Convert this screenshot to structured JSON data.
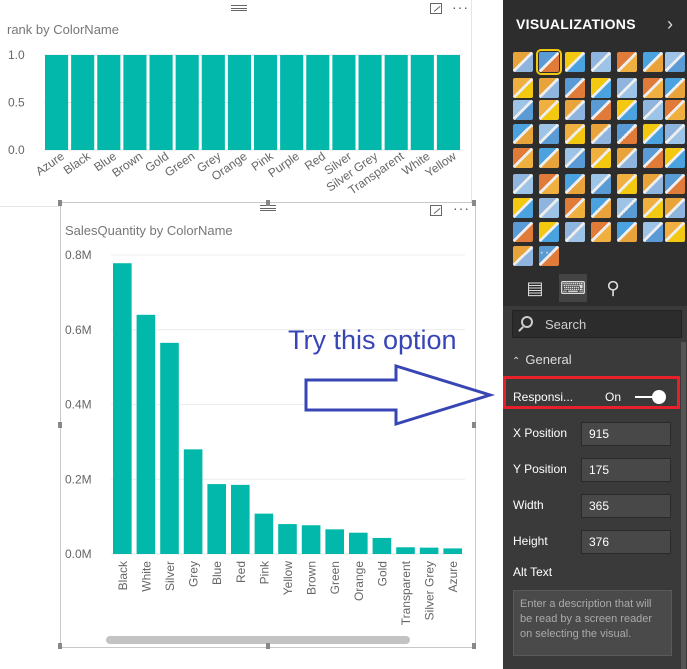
{
  "visual_rank": {
    "title": "rank by ColorName",
    "chart_data": {
      "type": "bar",
      "title": "rank by ColorName",
      "categories": [
        "Azure",
        "Black",
        "Blue",
        "Brown",
        "Gold",
        "Green",
        "Grey",
        "Orange",
        "Pink",
        "Purple",
        "Red",
        "Silver",
        "Silver Grey",
        "Transparent",
        "White",
        "Yellow"
      ],
      "values": [
        1,
        1,
        1,
        1,
        1,
        1,
        1,
        1,
        1,
        1,
        1,
        1,
        1,
        1,
        1,
        1
      ],
      "yticks": [
        "0.0",
        "0.5",
        "1.0"
      ],
      "ylim": [
        0,
        1.1
      ],
      "color": "#01b8aa"
    }
  },
  "visual_sales": {
    "title": "SalesQuantity by ColorName",
    "chart_data": {
      "type": "bar",
      "title": "SalesQuantity by ColorName",
      "categories": [
        "Black",
        "White",
        "Silver",
        "Grey",
        "Blue",
        "Red",
        "Pink",
        "Yellow",
        "Brown",
        "Green",
        "Orange",
        "Gold",
        "Transparent",
        "Silver Grey",
        "Azure"
      ],
      "values": [
        778000,
        640000,
        565000,
        280000,
        187000,
        185000,
        108000,
        80000,
        77000,
        66000,
        57000,
        43000,
        18000,
        17000,
        15000
      ],
      "yticks": [
        "0.0M",
        "0.2M",
        "0.4M",
        "0.6M",
        "0.8M"
      ],
      "ylim": [
        0,
        800000
      ],
      "color": "#01b8aa"
    }
  },
  "annotation": {
    "text": "Try this option"
  },
  "pane": {
    "title": "VISUALIZATIONS",
    "search_placeholder": "Search",
    "general_label": "General",
    "responsive_label": "Responsi...",
    "responsive_state": "On",
    "fields": [
      {
        "label": "X Position",
        "value": "915"
      },
      {
        "label": "Y Position",
        "value": "175"
      },
      {
        "label": "Width",
        "value": "365"
      },
      {
        "label": "Height",
        "value": "376"
      }
    ],
    "alt_text_label": "Alt Text",
    "alt_text_placeholder": "Enter a description that will be read by a screen reader on selecting the visual.",
    "more_visuals": "···"
  },
  "colors": {
    "accent_teal": "#01b8aa",
    "pane_bg": "#3a3a3a",
    "highlight_red": "#e8202a",
    "annotation_blue": "#3845b5"
  }
}
